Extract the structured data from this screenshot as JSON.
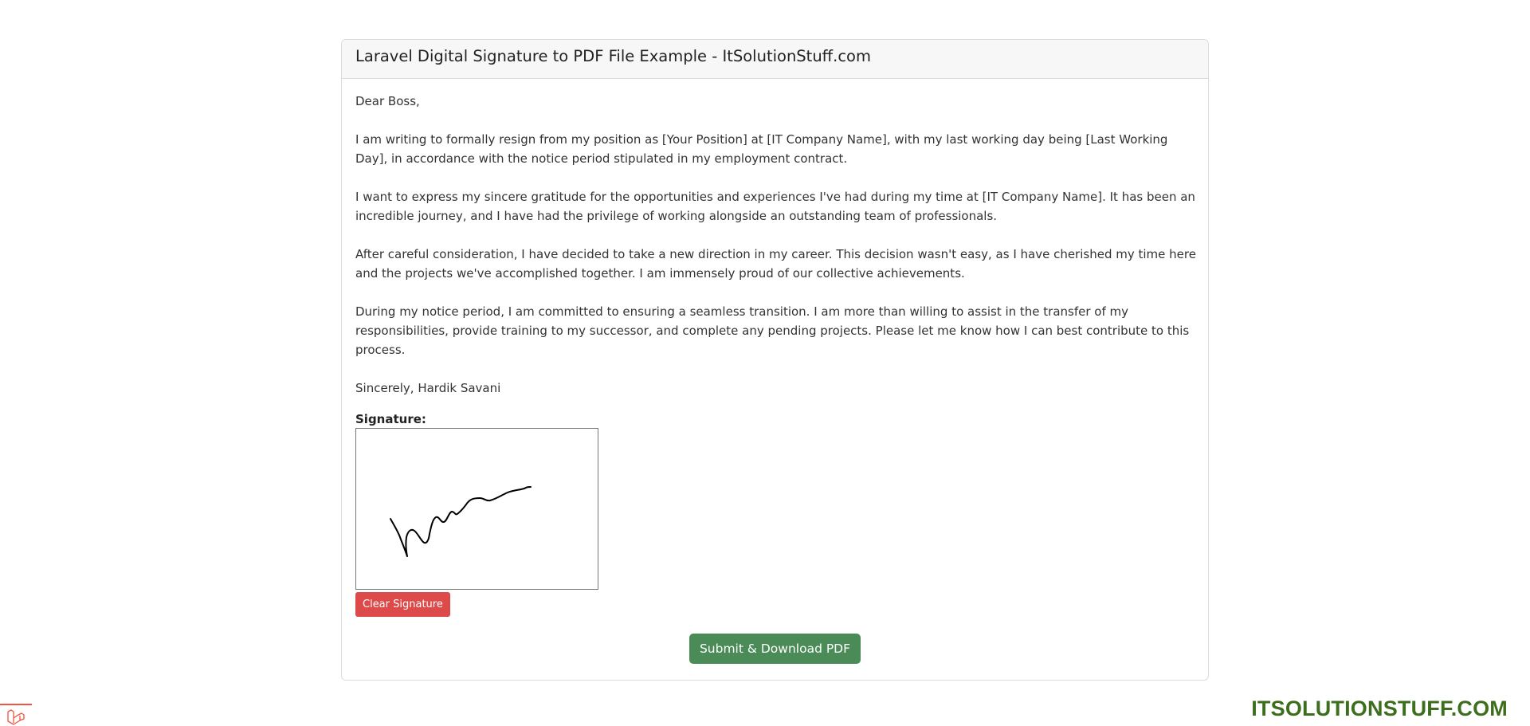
{
  "card": {
    "title": "Laravel Digital Signature to PDF File Example - ItSolutionStuff.com"
  },
  "letter": {
    "greeting": "Dear Boss,",
    "paragraphs": [
      "I am writing to formally resign from my position as [Your Position] at [IT Company Name], with my last working day being [Last Working Day], in accordance with the notice period stipulated in my employment contract.",
      "I want to express my sincere gratitude for the opportunities and experiences I've had during my time at [IT Company Name]. It has been an incredible journey, and I have had the privilege of working alongside an outstanding team of professionals.",
      "After careful consideration, I have decided to take a new direction in my career. This decision wasn't easy, as I have cherished my time here and the projects we've accomplished together. I am immensely proud of our collective achievements.",
      "During my notice period, I am committed to ensuring a seamless transition. I am more than willing to assist in the transfer of my responsibilities, provide training to my successor, and complete any pending projects. Please let me know how I can best contribute to this process."
    ],
    "closing": "Sincerely, Hardik Savani"
  },
  "signature": {
    "label": "Signature:",
    "clear_label": "Clear Signature"
  },
  "actions": {
    "submit_label": "Submit & Download PDF"
  },
  "footer": {
    "brand": "ITSOLUTIONSTUFF.COM"
  },
  "colors": {
    "clear_button": "#dc4a4a",
    "submit_button": "#4a8b57",
    "brand": "#3c6e1e"
  },
  "icons": {
    "corner": "laravel-icon"
  }
}
